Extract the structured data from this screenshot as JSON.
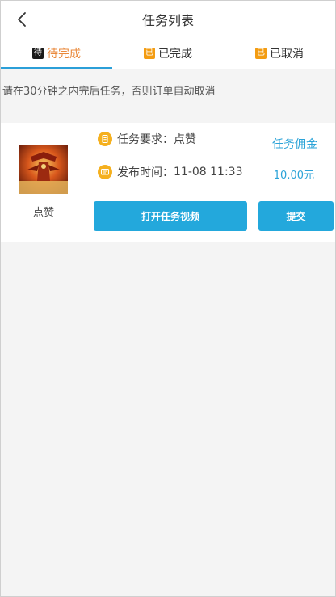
{
  "header": {
    "title": "任务列表"
  },
  "tabs": [
    {
      "label": "待完成",
      "icon_char": "待",
      "icon_color": "#1a1a1a",
      "active": true
    },
    {
      "label": "已完成",
      "icon_char": "已",
      "icon_color": "#f39c12",
      "active": false
    },
    {
      "label": "已取消",
      "icon_char": "已",
      "icon_color": "#f39c12",
      "active": false
    }
  ],
  "notice": "请在30分钟之内完后任务，否则订单自动取消",
  "task": {
    "thumbnail_label": "点赞",
    "requirement_label": "任务要求：",
    "requirement_value": "点赞",
    "publish_label": "发布时间：",
    "publish_value": "11-08 11:33",
    "commission_label": "任务佣金",
    "commission_amount": "10.00元",
    "open_button": "打开任务视频",
    "submit_button": "提交"
  },
  "colors": {
    "accent_blue": "#23a8dc",
    "active_tab": "#ea8a3c",
    "bullet_orange": "#f5b01e"
  }
}
